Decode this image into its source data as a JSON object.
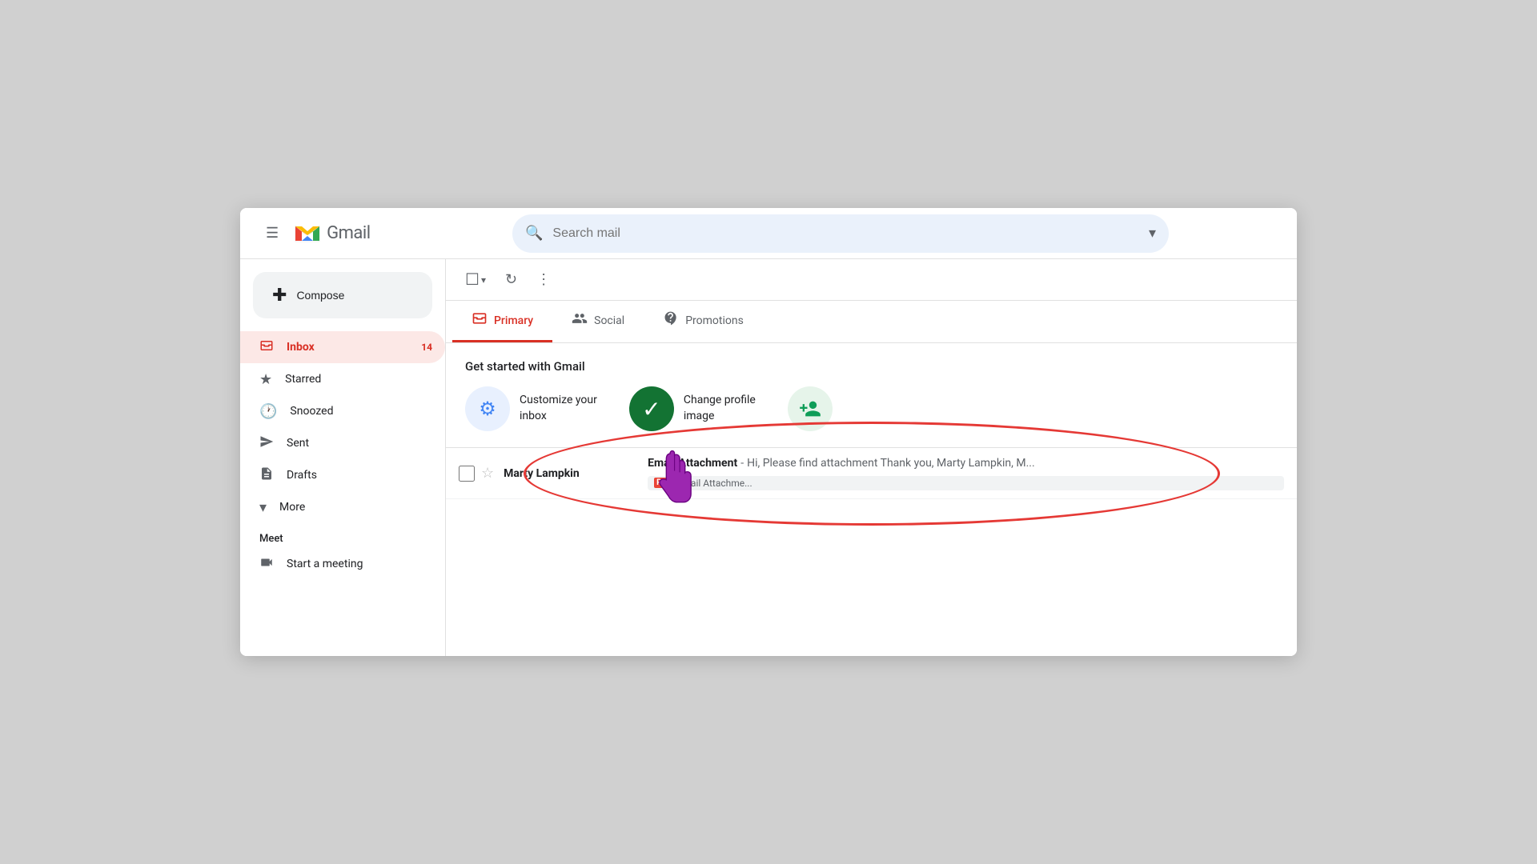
{
  "header": {
    "menu_label": "☰",
    "gmail_label": "Gmail",
    "search_placeholder": "Search mail"
  },
  "sidebar": {
    "compose_label": "Compose",
    "nav_items": [
      {
        "id": "inbox",
        "icon": "📥",
        "label": "Inbox",
        "badge": "14",
        "active": true
      },
      {
        "id": "starred",
        "icon": "★",
        "label": "Starred",
        "badge": "",
        "active": false
      },
      {
        "id": "snoozed",
        "icon": "🕐",
        "label": "Snoozed",
        "badge": "",
        "active": false
      },
      {
        "id": "sent",
        "icon": "▶",
        "label": "Sent",
        "badge": "",
        "active": false
      },
      {
        "id": "drafts",
        "icon": "📄",
        "label": "Drafts",
        "badge": "",
        "active": false
      },
      {
        "id": "more",
        "icon": "▾",
        "label": "More",
        "badge": "",
        "active": false
      }
    ],
    "meet_label": "Meet",
    "meet_items": [
      {
        "id": "start-meeting",
        "icon": "🎥",
        "label": "Start a meeting"
      }
    ]
  },
  "toolbar": {
    "select_all_label": "☐",
    "refresh_label": "↻",
    "more_label": "⋮"
  },
  "tabs": [
    {
      "id": "primary",
      "icon": "🖼",
      "label": "Primary",
      "active": true
    },
    {
      "id": "social",
      "icon": "👥",
      "label": "Social",
      "active": false
    },
    {
      "id": "promotions",
      "icon": "🏷",
      "label": "Promotions",
      "active": false
    }
  ],
  "get_started": {
    "title": "Get started with Gmail",
    "items": [
      {
        "id": "customize",
        "icon": "⚙",
        "icon_style": "blue",
        "label": "Customize your\ninbox"
      },
      {
        "id": "profile",
        "icon": "✓",
        "icon_style": "green",
        "label": "Change profile\nimage"
      },
      {
        "id": "add_people",
        "icon": "👤+",
        "icon_style": "green-light",
        "label": ""
      }
    ]
  },
  "emails": [
    {
      "id": "email-1",
      "sender": "Marty Lampkin",
      "subject": "Email Attachment",
      "preview": "Hi, Please find attachment Thank you, Marty Lampkin, M...",
      "attachment": "Email Attachme...",
      "starred": false,
      "unread": true
    }
  ]
}
